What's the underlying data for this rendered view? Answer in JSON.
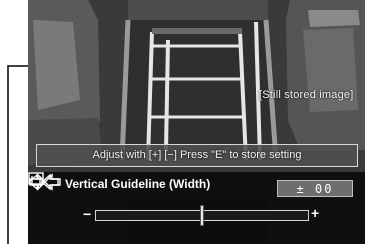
{
  "screen": {
    "still_image_label": "[Still stored image]",
    "instruction": "Adjust with [+] [−]   Press \"E\" to store setting",
    "guideline": {
      "title": "Vertical Guideline (Width)",
      "icon": "guideline-icon",
      "value": "± 00",
      "minus_label": "−",
      "plus_label": "+",
      "slider_level_percent": 50
    }
  },
  "colors": {
    "overlay_bg": "#0c0c0c",
    "guideline_white": "#e6e6e6",
    "value_box": "#6e6e6e"
  }
}
